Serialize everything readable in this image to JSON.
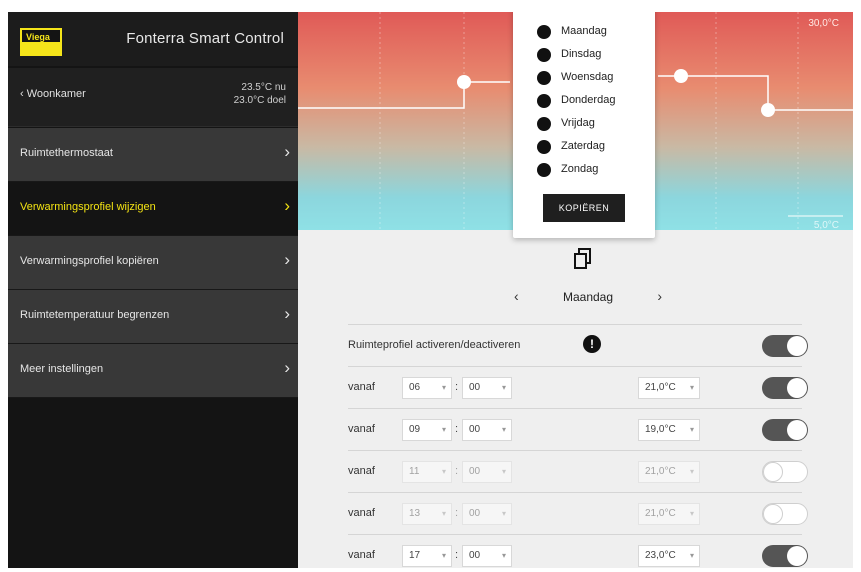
{
  "app": {
    "brand": "Viega",
    "title": "Fonterra Smart Control"
  },
  "room": {
    "back_label": "Woonkamer",
    "temp_now": "23.5°C nu",
    "temp_target": "23.0°C doel"
  },
  "menu": [
    {
      "label": "Ruimtethermostaat",
      "active": false
    },
    {
      "label": "Verwarmingsprofiel wijzigen",
      "active": true
    },
    {
      "label": "Verwarmingsprofiel kopiëren",
      "active": false
    },
    {
      "label": "Ruimtetemperatuur begrenzen",
      "active": false
    },
    {
      "label": "Meer instellingen",
      "active": false
    }
  ],
  "graph": {
    "max_label": "30,0°C",
    "min_label": "5,0°C"
  },
  "copy_popup": {
    "days": [
      "Maandag",
      "Dinsdag",
      "Woensdag",
      "Donderdag",
      "Vrijdag",
      "Zaterdag",
      "Zondag"
    ],
    "button": "KOPIËREN"
  },
  "icons": {
    "copy": "copy-icon",
    "info": "info-icon",
    "logo": "viega-logo"
  },
  "day_nav": {
    "prev": "‹",
    "current": "Maandag",
    "next": "›"
  },
  "profile_toggle": {
    "label": "Ruimteprofiel activeren/deactiveren",
    "info_glyph": "!",
    "on": true
  },
  "schedule": [
    {
      "prefix": "vanaf",
      "hour": "06",
      "minute": "00",
      "temp": "21,0°C",
      "enabled": true
    },
    {
      "prefix": "vanaf",
      "hour": "09",
      "minute": "00",
      "temp": "19,0°C",
      "enabled": true
    },
    {
      "prefix": "vanaf",
      "hour": "11",
      "minute": "00",
      "temp": "21,0°C",
      "enabled": false
    },
    {
      "prefix": "vanaf",
      "hour": "13",
      "minute": "00",
      "temp": "21,0°C",
      "enabled": false
    },
    {
      "prefix": "vanaf",
      "hour": "17",
      "minute": "00",
      "temp": "23,0°C",
      "enabled": true
    }
  ],
  "colors": {
    "accent": "#f3e313",
    "graph_top": "#e05a57",
    "graph_bottom": "#8fe1e6",
    "toggle_on": "#555555"
  }
}
